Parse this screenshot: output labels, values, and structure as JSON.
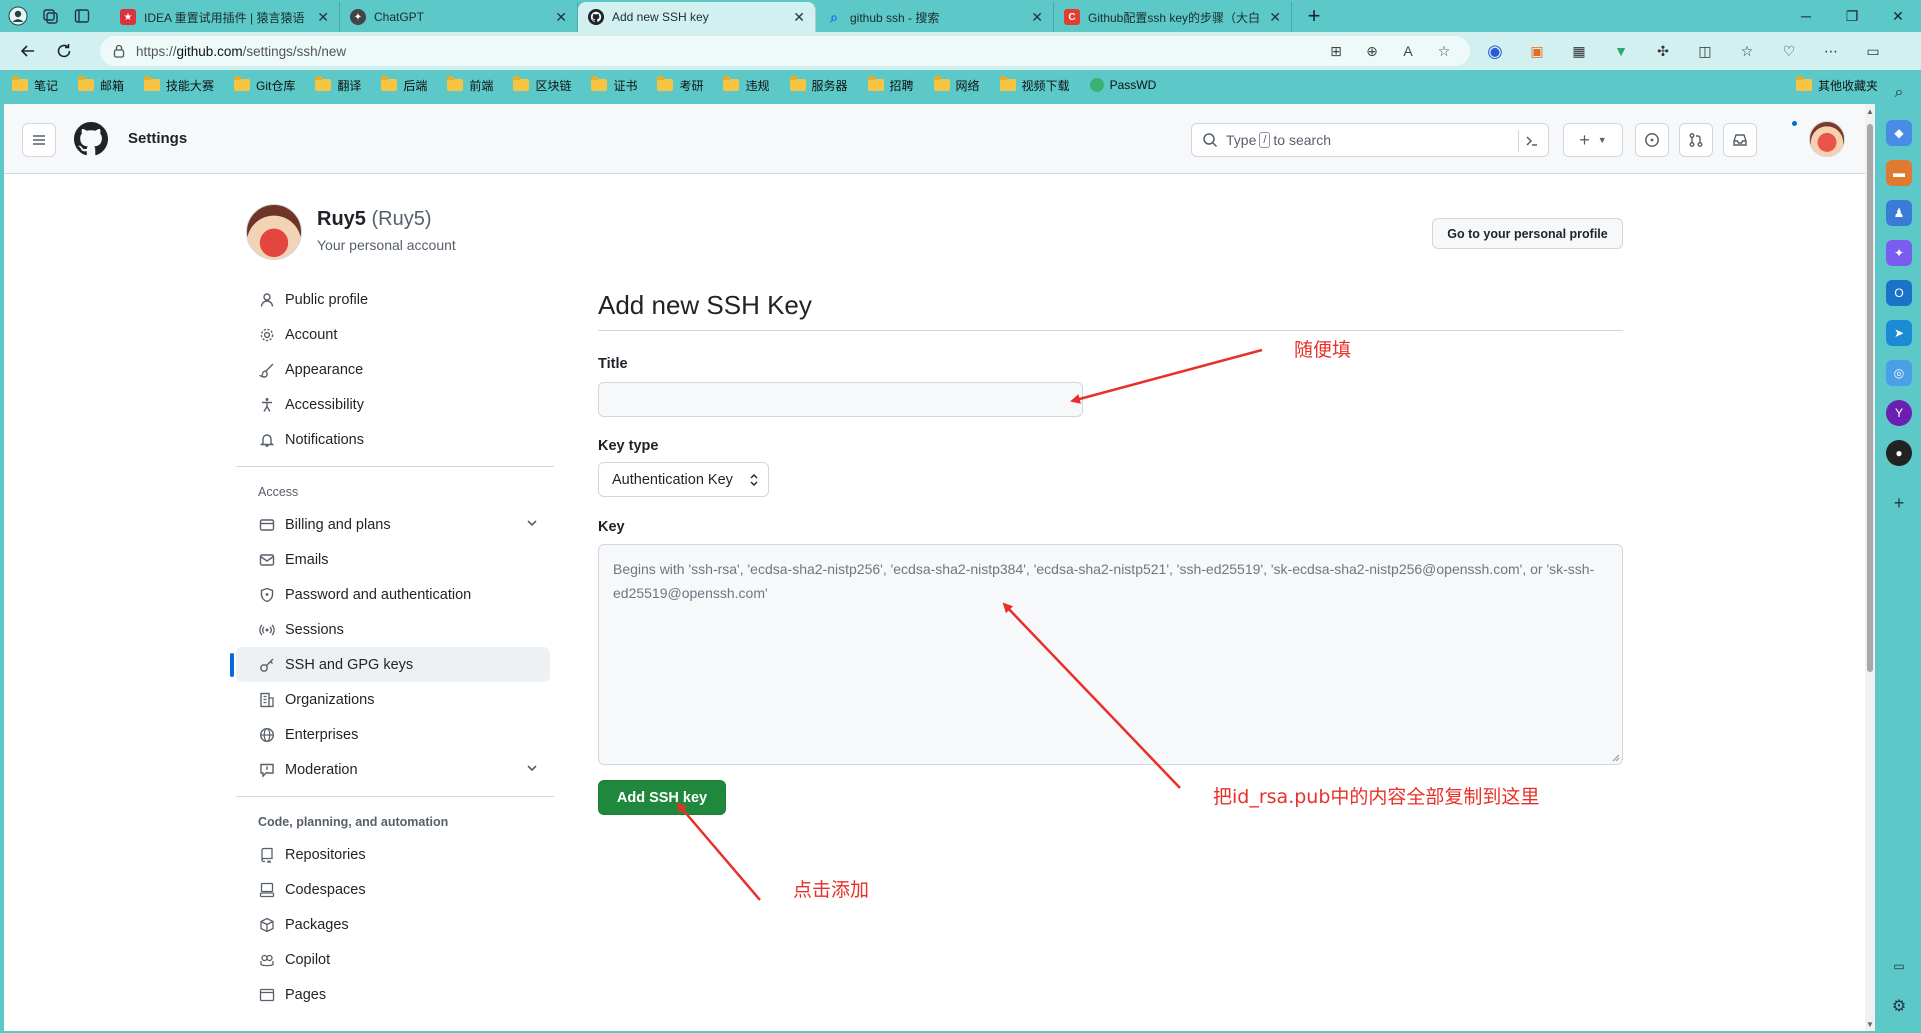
{
  "browser": {
    "tabs": [
      {
        "title": "IDEA 重置试用插件 | 猿言猿语",
        "fav_color": "#d8333a",
        "fav_glyph": "★"
      },
      {
        "title": "ChatGPT",
        "fav_color": "#444444",
        "fav_glyph": "✦"
      },
      {
        "title": "Add new SSH key",
        "fav_color": "#1f2328",
        "fav_glyph": "●",
        "active": true
      },
      {
        "title": "github ssh - 搜索",
        "fav_color": "#1a73e8",
        "fav_glyph": "⌕"
      },
      {
        "title": "Github配置ssh key的步骤（大白",
        "fav_color": "#e33d2f",
        "fav_glyph": "C"
      }
    ],
    "url_prefix": "https://",
    "url_host": "github.com",
    "url_path": "/settings/ssh/new",
    "bookmarks": [
      "笔记",
      "邮箱",
      "技能大赛",
      "Git仓库",
      "翻译",
      "后端",
      "前端",
      "区块链",
      "证书",
      "考研",
      "违规",
      "服务器",
      "招聘",
      "网络",
      "视频下载"
    ],
    "bookmark_passwd": "PassWD",
    "bookmark_other": "其他收藏夹"
  },
  "header": {
    "title": "Settings",
    "search_prefix": "Type",
    "search_slash": "/",
    "search_suffix": "to search"
  },
  "user": {
    "name": "Ruy5",
    "login": "(Ruy5)",
    "subtitle": "Your personal account",
    "profile_button": "Go to your personal profile"
  },
  "nav": {
    "group1": [
      "Public profile",
      "Account",
      "Appearance",
      "Accessibility",
      "Notifications"
    ],
    "access_heading": "Access",
    "group2": [
      "Billing and plans",
      "Emails",
      "Password and authentication",
      "Sessions",
      "SSH and GPG keys",
      "Organizations",
      "Enterprises",
      "Moderation"
    ],
    "code_heading": "Code, planning, and automation",
    "group3": [
      "Repositories",
      "Codespaces",
      "Packages",
      "Copilot",
      "Pages"
    ]
  },
  "form": {
    "heading": "Add new SSH Key",
    "title_label": "Title",
    "title_value": "",
    "key_type_label": "Key type",
    "key_type_value": "Authentication Key",
    "key_label": "Key",
    "key_placeholder": "Begins with 'ssh-rsa', 'ecdsa-sha2-nistp256', 'ecdsa-sha2-nistp384', 'ecdsa-sha2-nistp521', 'ssh-ed25519', 'sk-ecdsa-sha2-nistp256@openssh.com', or 'sk-ssh-ed25519@openssh.com'",
    "submit_label": "Add SSH key"
  },
  "annotations": {
    "title_note": "随便填",
    "key_note": "把id_rsa.pub中的内容全部复制到这里",
    "button_note": "点击添加",
    "color": "#e8302a"
  }
}
